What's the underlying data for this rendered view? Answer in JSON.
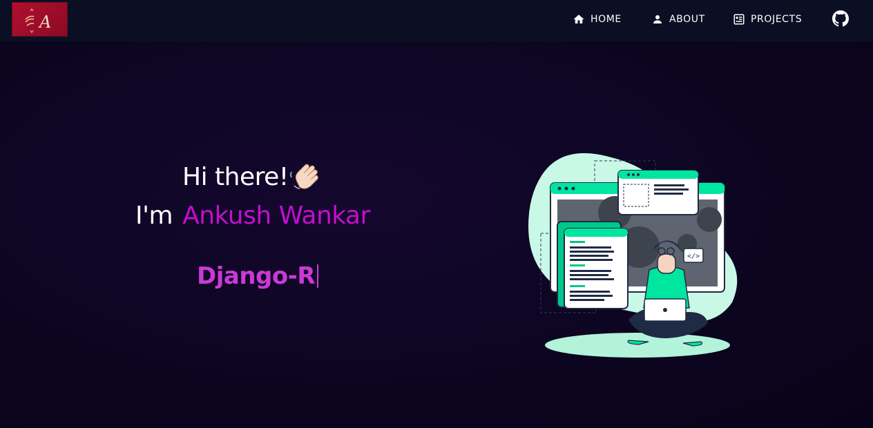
{
  "nav": {
    "logo_letter": "A",
    "items": [
      {
        "label": "HOME",
        "icon": "home-icon"
      },
      {
        "label": "ABOUT",
        "icon": "person-icon"
      },
      {
        "label": "PROJECTS",
        "icon": "projects-icon"
      }
    ],
    "github_icon": "github-icon"
  },
  "hero": {
    "greeting": "Hi there!",
    "wave_icon": "waving-hand-icon",
    "intro_prefix": "I'm",
    "name": "Ankush Wankar",
    "typed_text": "Django-R"
  },
  "colors": {
    "navbar": "#0b0f24",
    "background": "#0c0520",
    "name": "#c50ecf",
    "typed": "#c93ad6",
    "illustration_accent": "#00e6a0"
  }
}
